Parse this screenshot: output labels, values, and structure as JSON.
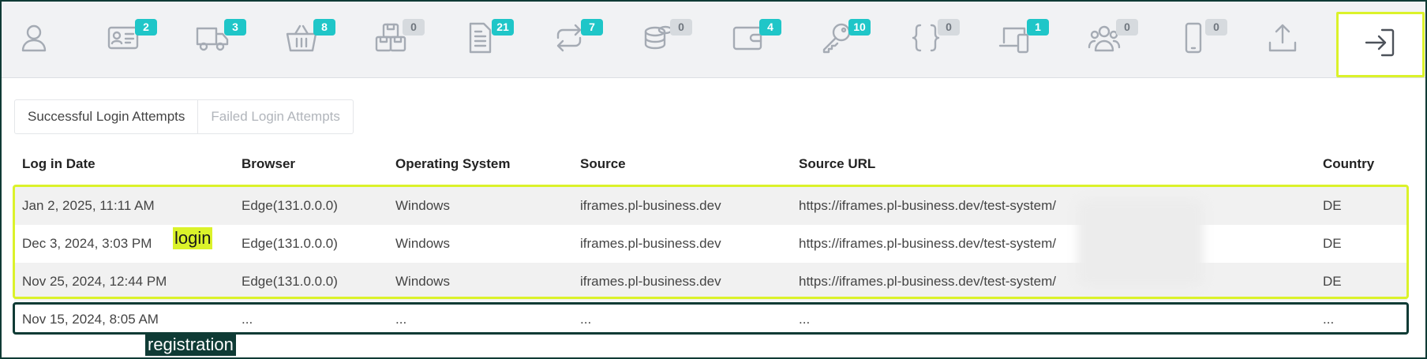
{
  "icon_bar": {
    "items": [
      {
        "icon": "user-icon",
        "badge": ""
      },
      {
        "icon": "id-card-icon",
        "badge": "2"
      },
      {
        "icon": "truck-icon",
        "badge": "3"
      },
      {
        "icon": "basket-icon",
        "badge": "8"
      },
      {
        "icon": "boxes-icon",
        "badge": "0"
      },
      {
        "icon": "document-icon",
        "badge": "21"
      },
      {
        "icon": "repeat-icon",
        "badge": "7"
      },
      {
        "icon": "coins-icon",
        "badge": "0"
      },
      {
        "icon": "wallet-icon",
        "badge": "4"
      },
      {
        "icon": "key-icon",
        "badge": "10"
      },
      {
        "icon": "braces-icon",
        "badge": "0"
      },
      {
        "icon": "devices-icon",
        "badge": "1"
      },
      {
        "icon": "users-icon",
        "badge": "0"
      },
      {
        "icon": "mobile-icon",
        "badge": "0"
      },
      {
        "icon": "upload-icon",
        "badge": ""
      },
      {
        "icon": "login-icon",
        "badge": ""
      }
    ]
  },
  "tabs": {
    "successful": "Successful Login Attempts",
    "failed": "Failed Login Attempts"
  },
  "table": {
    "headers": {
      "date": "Log in Date",
      "browser": "Browser",
      "os": "Operating System",
      "source": "Source",
      "url": "Source URL",
      "country": "Country"
    },
    "rows": [
      {
        "date": "Jan 2, 2025, 11:11 AM",
        "browser": "Edge(131.0.0.0)",
        "os": "Windows",
        "source": "iframes.pl-business.dev",
        "url": "https://iframes.pl-business.dev/test-system/",
        "country": "DE"
      },
      {
        "date": "Dec 3, 2024, 3:03 PM",
        "browser": "Edge(131.0.0.0)",
        "os": "Windows",
        "source": "iframes.pl-business.dev",
        "url": "https://iframes.pl-business.dev/test-system/",
        "country": "DE"
      },
      {
        "date": "Nov 25, 2024, 12:44 PM",
        "browser": "Edge(131.0.0.0)",
        "os": "Windows",
        "source": "iframes.pl-business.dev",
        "url": "https://iframes.pl-business.dev/test-system/",
        "country": "DE"
      },
      {
        "date": "Nov 15, 2024, 8:05 AM",
        "browser": "...",
        "os": "...",
        "source": "...",
        "url": "...",
        "country": "..."
      }
    ]
  },
  "annotations": {
    "login": "login",
    "registration": "registration"
  },
  "colors": {
    "badge_active": "#1fc6c8",
    "badge_zero": "#d6dade",
    "highlight_login": "#dbf22a",
    "highlight_registration": "#0f3b35"
  }
}
